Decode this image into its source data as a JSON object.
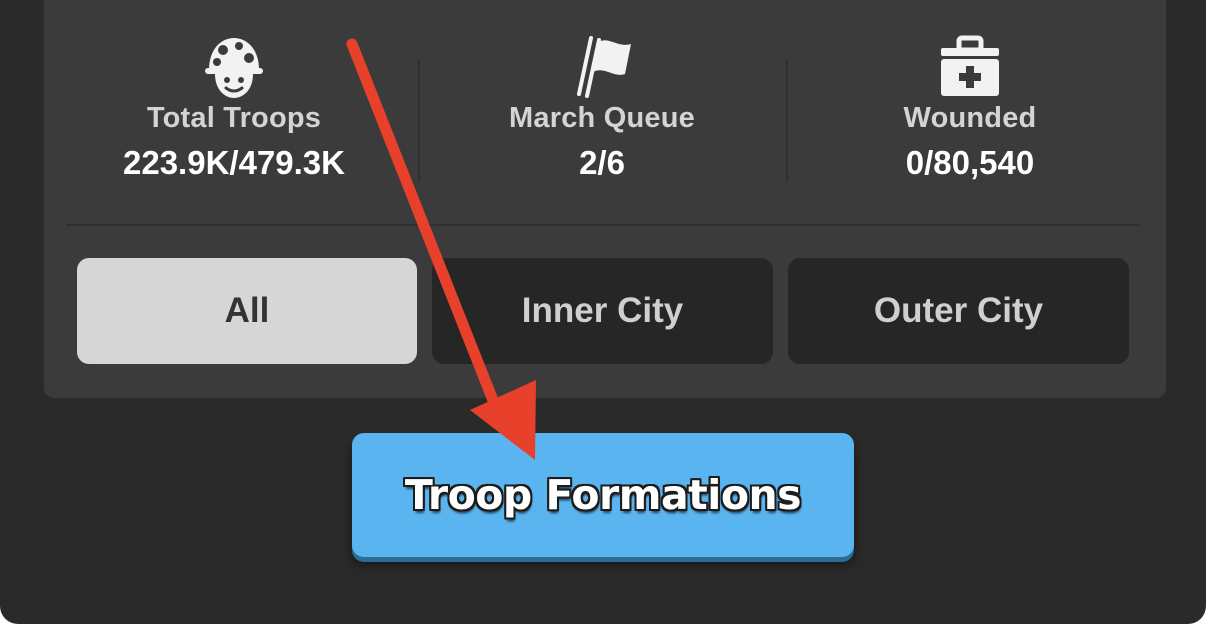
{
  "stats": [
    {
      "label": "Total Troops",
      "value": "223.9K/479.3K",
      "icon": "soldier-helmet-icon"
    },
    {
      "label": "March Queue",
      "value": "2/6",
      "icon": "flag-icon"
    },
    {
      "label": "Wounded",
      "value": "0/80,540",
      "icon": "medical-kit-icon"
    }
  ],
  "tabs": [
    {
      "label": "All",
      "active": true
    },
    {
      "label": "Inner City",
      "active": false
    },
    {
      "label": "Outer City",
      "active": false
    }
  ],
  "action": {
    "label": "Troop Formations"
  },
  "colors": {
    "background": "#2a2a2a",
    "panel": "#3b3b3b",
    "tab_active": "#d6d6d6",
    "tab_inactive": "#262626",
    "button": "#5ab4ef",
    "annotation_arrow": "#e8412b"
  }
}
